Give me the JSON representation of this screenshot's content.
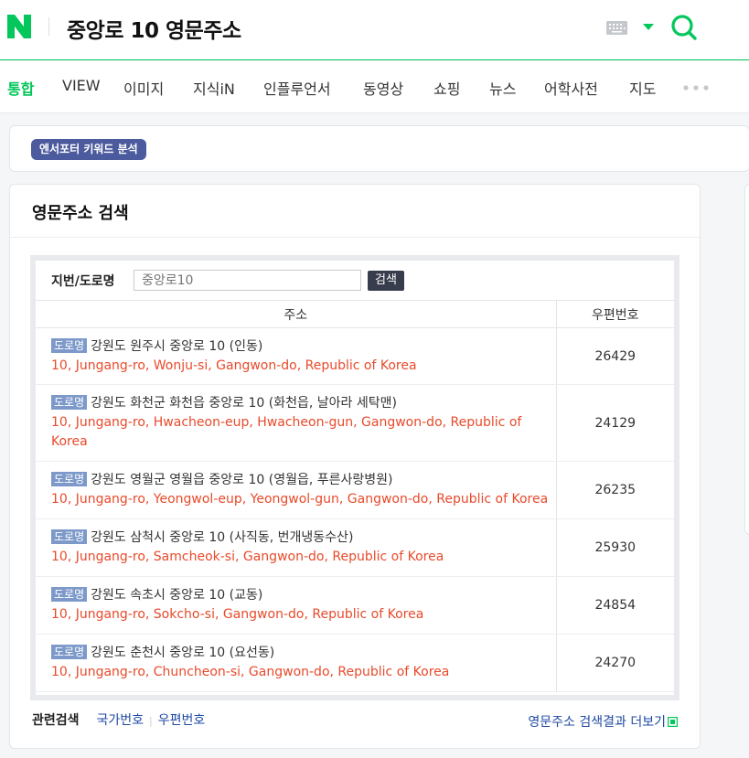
{
  "header": {
    "query": "중앙로 10 영문주소",
    "brand_color": "#03c75a"
  },
  "tabs": [
    {
      "label": "통합",
      "active": true
    },
    {
      "label": "VIEW"
    },
    {
      "label": "이미지"
    },
    {
      "label": "지식iN"
    },
    {
      "label": "인플루언서"
    },
    {
      "label": "동영상"
    },
    {
      "label": "쇼핑"
    },
    {
      "label": "뉴스"
    },
    {
      "label": "어학사전"
    },
    {
      "label": "지도"
    }
  ],
  "keyword_badge": "엔서포터 키워드 분석",
  "card": {
    "title": "영문주소 검색",
    "search_label": "지번/도로명",
    "search_placeholder": "중앙로10",
    "search_button": "검색",
    "columns": {
      "address": "주소",
      "zip": "우편번호"
    },
    "road_badge": "도로명",
    "rows": [
      {
        "ko": "강원도 원주시 중앙로 10 (인동)",
        "en": "10, Jungang-ro, Wonju-si, Gangwon-do, Republic of Korea",
        "zip": "26429"
      },
      {
        "ko": "강원도 화천군 화천읍 중앙로 10 (화천읍, 날아라 세탁맨)",
        "en": "10, Jungang-ro, Hwacheon-eup, Hwacheon-gun, Gangwon-do, Republic of Korea",
        "zip": "24129"
      },
      {
        "ko": "강원도 영월군 영월읍 중앙로 10 (영월읍, 푸른사랑병원)",
        "en": "10, Jungang-ro, Yeongwol-eup, Yeongwol-gun, Gangwon-do, Republic of Korea",
        "zip": "26235"
      },
      {
        "ko": "강원도 삼척시 중앙로 10 (사직동, 번개냉동수산)",
        "en": "10, Jungang-ro, Samcheok-si, Gangwon-do, Republic of Korea",
        "zip": "25930"
      },
      {
        "ko": "강원도 속초시 중앙로 10 (교동)",
        "en": "10, Jungang-ro, Sokcho-si, Gangwon-do, Republic of Korea",
        "zip": "24854"
      },
      {
        "ko": "강원도 춘천시 중앙로 10 (요선동)",
        "en": "10, Jungang-ro, Chuncheon-si, Gangwon-do, Republic of Korea",
        "zip": "24270"
      }
    ],
    "related_label": "관련검색",
    "related_links": [
      "국가번호",
      "우편번호"
    ],
    "more_link": "영문주소 검색결과 더보기"
  }
}
